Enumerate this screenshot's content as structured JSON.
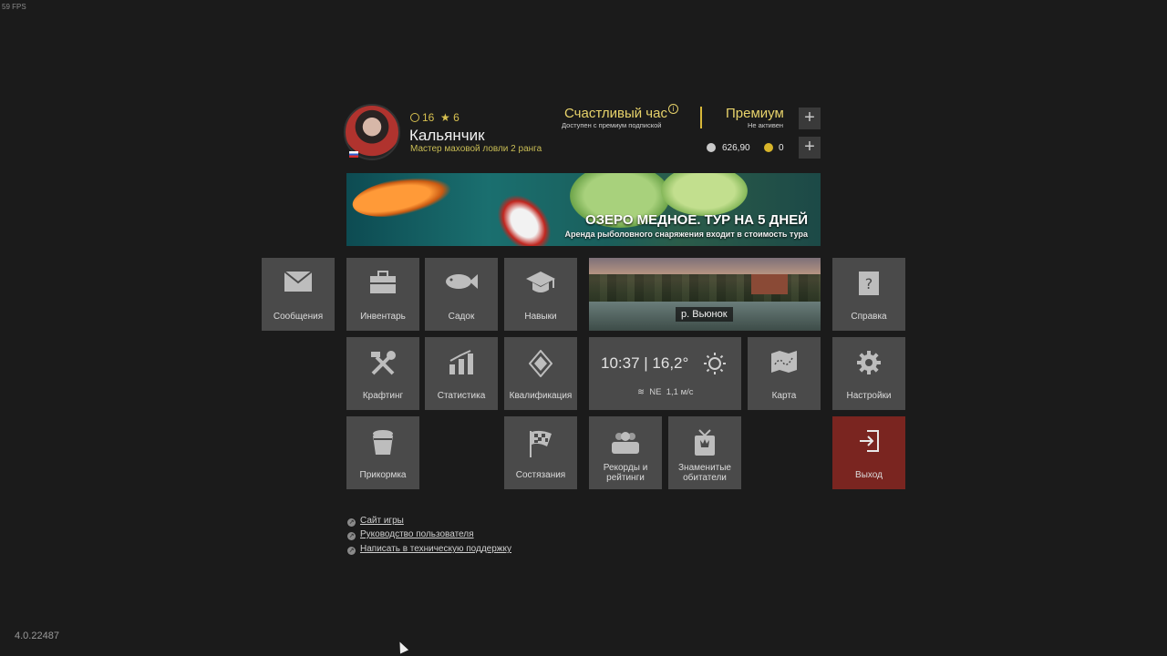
{
  "overlay": {
    "fps": "59 FPS",
    "version": "4.0.22487"
  },
  "profile": {
    "level": "16",
    "stars": "6",
    "username": "Кальянчик",
    "rank": "Мастер маховой ловли 2 ранга"
  },
  "happy_hour": {
    "title": "Счастливый час",
    "subtitle": "Доступен с премиум подпиской"
  },
  "premium": {
    "title": "Премиум",
    "subtitle": "Не активен"
  },
  "currency": {
    "silver": "626,90",
    "gold": "0"
  },
  "banner": {
    "title": "ОЗЕРО МЕДНОЕ. ТУР НА 5 ДНЕЙ",
    "subtitle": "Аренда рыболовного снаряжения входит в стоимость тура"
  },
  "tiles": {
    "messages": "Сообщения",
    "inventory": "Инвентарь",
    "keepnet": "Садок",
    "skills": "Навыки",
    "help": "Справка",
    "crafting": "Крафтинг",
    "statistics": "Статистика",
    "qualification": "Квалификация",
    "map": "Карта",
    "settings": "Настройки",
    "groundbait": "Прикормка",
    "competitions": "Состязания",
    "records_line1": "Рекорды и",
    "records_line2": "рейтинги",
    "famous_line1": "Знаменитые",
    "famous_line2": "обитатели",
    "exit": "Выход"
  },
  "location": {
    "name": "р. Вьюнок"
  },
  "weather": {
    "time_temp": "10:37 | 16,2°",
    "wind_dir": "NE",
    "wind_speed": "1,1 м/с"
  },
  "links": {
    "site": "Сайт игры",
    "guide": "Руководство пользователя",
    "support": "Написать в техническую поддержку"
  },
  "colors": {
    "background": "#1b1b1b",
    "tile": "#4a4a4a",
    "exit_tile": "#7a2520",
    "accent": "#e8d36b"
  }
}
